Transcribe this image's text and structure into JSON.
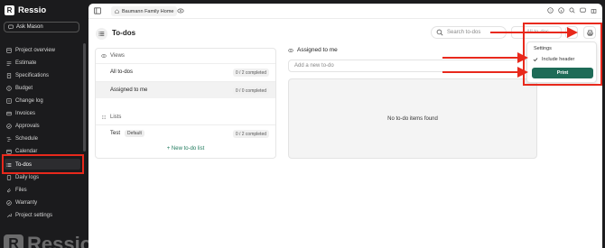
{
  "app": {
    "name": "Ressio",
    "watermark": "Ressio"
  },
  "sidebar": {
    "ask_label": "Ask Mason",
    "items": [
      {
        "label": "Project overview",
        "icon": "overview-icon"
      },
      {
        "label": "Estimate",
        "icon": "estimate-icon"
      },
      {
        "label": "Specifications",
        "icon": "specifications-icon"
      },
      {
        "label": "Budget",
        "icon": "budget-icon"
      },
      {
        "label": "Change log",
        "icon": "change-log-icon"
      },
      {
        "label": "Invoices",
        "icon": "invoices-icon"
      },
      {
        "label": "Approvals",
        "icon": "approvals-icon"
      },
      {
        "label": "Schedule",
        "icon": "schedule-icon"
      },
      {
        "label": "Calendar",
        "icon": "calendar-icon"
      },
      {
        "label": "To-dos",
        "icon": "todos-icon",
        "active": true
      },
      {
        "label": "Daily logs",
        "icon": "daily-logs-icon"
      },
      {
        "label": "Files",
        "icon": "files-icon"
      },
      {
        "label": "Warranty",
        "icon": "warranty-icon"
      },
      {
        "label": "Project settings",
        "icon": "settings-icon"
      }
    ]
  },
  "topbar": {
    "project": "Baumann Family Home"
  },
  "header": {
    "title": "To-dos",
    "search_placeholder": "Search to-dos",
    "filter_label": "All to-dos"
  },
  "views": {
    "heading": "Views",
    "items": [
      {
        "label": "All to-dos",
        "count": "0 / 2 completed"
      },
      {
        "label": "Assigned to me",
        "count": "0 / 0 completed",
        "selected": true
      }
    ]
  },
  "lists": {
    "heading": "Lists",
    "items": [
      {
        "label": "Test",
        "badge": "Default",
        "count": "0 / 2 completed"
      }
    ],
    "new_label": "New to-do list"
  },
  "detail": {
    "heading": "Assigned to me",
    "add_placeholder": "Add a new to-do",
    "empty": "No to-do items found"
  },
  "print_menu": {
    "title": "Settings",
    "include_header": "Include header",
    "include_header_checked": true,
    "print_label": "Print"
  },
  "colors": {
    "sidebar_bg": "#1b1b1d",
    "accent": "#1e6b57",
    "annotation": "#e8291c"
  }
}
